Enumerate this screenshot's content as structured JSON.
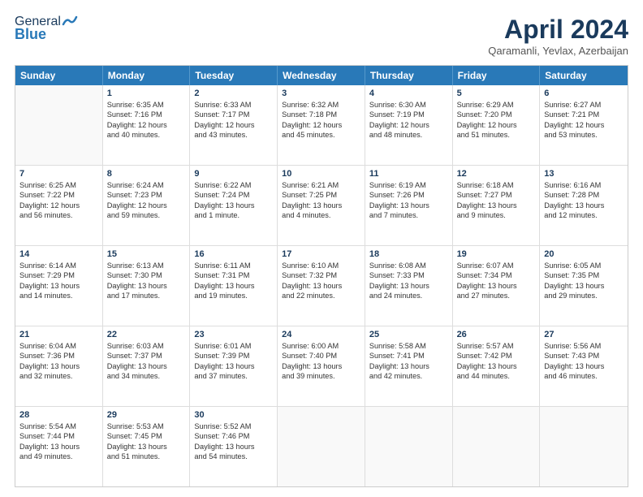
{
  "header": {
    "logo_general": "General",
    "logo_blue": "Blue",
    "title": "April 2024",
    "subtitle": "Qaramanli, Yevlax, Azerbaijan"
  },
  "weekdays": [
    "Sunday",
    "Monday",
    "Tuesday",
    "Wednesday",
    "Thursday",
    "Friday",
    "Saturday"
  ],
  "rows": [
    [
      {
        "day": "",
        "sunrise": "",
        "sunset": "",
        "daylight": ""
      },
      {
        "day": "1",
        "sunrise": "Sunrise: 6:35 AM",
        "sunset": "Sunset: 7:16 PM",
        "daylight": "Daylight: 12 hours and 40 minutes."
      },
      {
        "day": "2",
        "sunrise": "Sunrise: 6:33 AM",
        "sunset": "Sunset: 7:17 PM",
        "daylight": "Daylight: 12 hours and 43 minutes."
      },
      {
        "day": "3",
        "sunrise": "Sunrise: 6:32 AM",
        "sunset": "Sunset: 7:18 PM",
        "daylight": "Daylight: 12 hours and 45 minutes."
      },
      {
        "day": "4",
        "sunrise": "Sunrise: 6:30 AM",
        "sunset": "Sunset: 7:19 PM",
        "daylight": "Daylight: 12 hours and 48 minutes."
      },
      {
        "day": "5",
        "sunrise": "Sunrise: 6:29 AM",
        "sunset": "Sunset: 7:20 PM",
        "daylight": "Daylight: 12 hours and 51 minutes."
      },
      {
        "day": "6",
        "sunrise": "Sunrise: 6:27 AM",
        "sunset": "Sunset: 7:21 PM",
        "daylight": "Daylight: 12 hours and 53 minutes."
      }
    ],
    [
      {
        "day": "7",
        "sunrise": "Sunrise: 6:25 AM",
        "sunset": "Sunset: 7:22 PM",
        "daylight": "Daylight: 12 hours and 56 minutes."
      },
      {
        "day": "8",
        "sunrise": "Sunrise: 6:24 AM",
        "sunset": "Sunset: 7:23 PM",
        "daylight": "Daylight: 12 hours and 59 minutes."
      },
      {
        "day": "9",
        "sunrise": "Sunrise: 6:22 AM",
        "sunset": "Sunset: 7:24 PM",
        "daylight": "Daylight: 13 hours and 1 minute."
      },
      {
        "day": "10",
        "sunrise": "Sunrise: 6:21 AM",
        "sunset": "Sunset: 7:25 PM",
        "daylight": "Daylight: 13 hours and 4 minutes."
      },
      {
        "day": "11",
        "sunrise": "Sunrise: 6:19 AM",
        "sunset": "Sunset: 7:26 PM",
        "daylight": "Daylight: 13 hours and 7 minutes."
      },
      {
        "day": "12",
        "sunrise": "Sunrise: 6:18 AM",
        "sunset": "Sunset: 7:27 PM",
        "daylight": "Daylight: 13 hours and 9 minutes."
      },
      {
        "day": "13",
        "sunrise": "Sunrise: 6:16 AM",
        "sunset": "Sunset: 7:28 PM",
        "daylight": "Daylight: 13 hours and 12 minutes."
      }
    ],
    [
      {
        "day": "14",
        "sunrise": "Sunrise: 6:14 AM",
        "sunset": "Sunset: 7:29 PM",
        "daylight": "Daylight: 13 hours and 14 minutes."
      },
      {
        "day": "15",
        "sunrise": "Sunrise: 6:13 AM",
        "sunset": "Sunset: 7:30 PM",
        "daylight": "Daylight: 13 hours and 17 minutes."
      },
      {
        "day": "16",
        "sunrise": "Sunrise: 6:11 AM",
        "sunset": "Sunset: 7:31 PM",
        "daylight": "Daylight: 13 hours and 19 minutes."
      },
      {
        "day": "17",
        "sunrise": "Sunrise: 6:10 AM",
        "sunset": "Sunset: 7:32 PM",
        "daylight": "Daylight: 13 hours and 22 minutes."
      },
      {
        "day": "18",
        "sunrise": "Sunrise: 6:08 AM",
        "sunset": "Sunset: 7:33 PM",
        "daylight": "Daylight: 13 hours and 24 minutes."
      },
      {
        "day": "19",
        "sunrise": "Sunrise: 6:07 AM",
        "sunset": "Sunset: 7:34 PM",
        "daylight": "Daylight: 13 hours and 27 minutes."
      },
      {
        "day": "20",
        "sunrise": "Sunrise: 6:05 AM",
        "sunset": "Sunset: 7:35 PM",
        "daylight": "Daylight: 13 hours and 29 minutes."
      }
    ],
    [
      {
        "day": "21",
        "sunrise": "Sunrise: 6:04 AM",
        "sunset": "Sunset: 7:36 PM",
        "daylight": "Daylight: 13 hours and 32 minutes."
      },
      {
        "day": "22",
        "sunrise": "Sunrise: 6:03 AM",
        "sunset": "Sunset: 7:37 PM",
        "daylight": "Daylight: 13 hours and 34 minutes."
      },
      {
        "day": "23",
        "sunrise": "Sunrise: 6:01 AM",
        "sunset": "Sunset: 7:39 PM",
        "daylight": "Daylight: 13 hours and 37 minutes."
      },
      {
        "day": "24",
        "sunrise": "Sunrise: 6:00 AM",
        "sunset": "Sunset: 7:40 PM",
        "daylight": "Daylight: 13 hours and 39 minutes."
      },
      {
        "day": "25",
        "sunrise": "Sunrise: 5:58 AM",
        "sunset": "Sunset: 7:41 PM",
        "daylight": "Daylight: 13 hours and 42 minutes."
      },
      {
        "day": "26",
        "sunrise": "Sunrise: 5:57 AM",
        "sunset": "Sunset: 7:42 PM",
        "daylight": "Daylight: 13 hours and 44 minutes."
      },
      {
        "day": "27",
        "sunrise": "Sunrise: 5:56 AM",
        "sunset": "Sunset: 7:43 PM",
        "daylight": "Daylight: 13 hours and 46 minutes."
      }
    ],
    [
      {
        "day": "28",
        "sunrise": "Sunrise: 5:54 AM",
        "sunset": "Sunset: 7:44 PM",
        "daylight": "Daylight: 13 hours and 49 minutes."
      },
      {
        "day": "29",
        "sunrise": "Sunrise: 5:53 AM",
        "sunset": "Sunset: 7:45 PM",
        "daylight": "Daylight: 13 hours and 51 minutes."
      },
      {
        "day": "30",
        "sunrise": "Sunrise: 5:52 AM",
        "sunset": "Sunset: 7:46 PM",
        "daylight": "Daylight: 13 hours and 54 minutes."
      },
      {
        "day": "",
        "sunrise": "",
        "sunset": "",
        "daylight": ""
      },
      {
        "day": "",
        "sunrise": "",
        "sunset": "",
        "daylight": ""
      },
      {
        "day": "",
        "sunrise": "",
        "sunset": "",
        "daylight": ""
      },
      {
        "day": "",
        "sunrise": "",
        "sunset": "",
        "daylight": ""
      }
    ]
  ]
}
